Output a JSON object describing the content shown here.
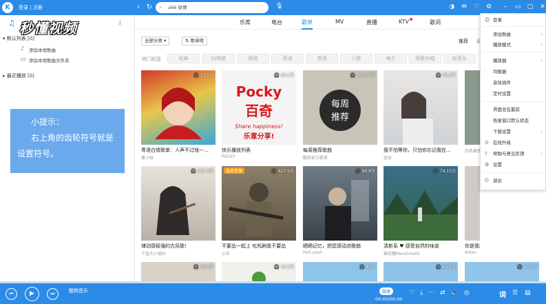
{
  "topbar": {
    "logo": "K",
    "login": "登录 | 注册",
    "search_value": "a66 梁博",
    "icons": [
      "back-icon",
      "refresh-icon",
      "mic-icon",
      "skin-icon",
      "mail-icon",
      "game-icon",
      "gear-icon",
      "minimize-icon",
      "mini-mode-icon",
      "close-icon"
    ]
  },
  "watermark": "秒懂视频",
  "sidebar": {
    "default_list": "默认列表 [0]",
    "add_local": "添加本地歌曲",
    "add_folder": "添加本地歌曲文件夹",
    "recent": "最近播放 [0]"
  },
  "tip": {
    "line1": "小提示：",
    "line2": "右上角的齿轮符号就是",
    "line3": "设置符号。"
  },
  "tabs": [
    {
      "label": "乐库",
      "active": false
    },
    {
      "label": "电台",
      "active": false
    },
    {
      "label": "歌单",
      "active": true
    },
    {
      "label": "MV",
      "active": false
    },
    {
      "label": "直播",
      "active": false
    },
    {
      "label": "KTV",
      "active": false
    },
    {
      "label": "歌词",
      "active": false
    }
  ],
  "filters": {
    "category": "全部分类 ▾",
    "chart": "歌单榜"
  },
  "sort": {
    "recommend": "推荐",
    "latest": "最"
  },
  "hot_tags_label": "热门标签",
  "hot_tags": [
    "经典",
    "DJ热碟",
    "网络",
    "英语",
    "粤语",
    "儿歌",
    "电子",
    "情歌对唱",
    "轻音乐"
  ],
  "cards_row1": [
    {
      "title": "粤语白情歌单：人声不过戏一...",
      "sub": "黄小妍",
      "plays": "73.5万"
    },
    {
      "title": "快乐播放列表",
      "sub": "POCKY",
      "plays": "29.1万"
    },
    {
      "title": "每周推荐歌曲",
      "sub": "酷狗官方歌单",
      "plays": "3600.6万"
    },
    {
      "title": "我不怕等你，只怕你忘记我在...",
      "sub": "念安",
      "plays": "58.6万"
    },
    {
      "title": "",
      "sub": "白色暑假",
      "plays": ""
    }
  ],
  "cards_row2": [
    {
      "title": "律动感极强的古风歌！",
      "sub": "千金大小姐M",
      "plays": "121.3万",
      "vip": ""
    },
    {
      "title": "不要怂一起上 吃鸡刷盘不要怂",
      "sub": "小灰",
      "plays": "427.9万",
      "vip": "会员专享"
    },
    {
      "title": "晒晒记忆，把您感动进歌曲",
      "sub": "Hell yeah",
      "plays": "90.8万",
      "vip": ""
    },
    {
      "title": "清新系 ♥ 感受自然的味道",
      "sub": "棉花糖Marshmello",
      "plays": "74.15万",
      "vip": ""
    },
    {
      "title": "你是我想念，是你想忘记的人",
      "sub": "Aiden",
      "plays": "",
      "vip": ""
    }
  ],
  "cards_row3": [
    {
      "plays": "38.7万"
    },
    {
      "plays": "16.5万"
    },
    {
      "plays": "42万"
    },
    {
      "plays": "63.2万"
    },
    {
      "plays": "67.6万"
    }
  ],
  "menu": {
    "items": [
      {
        "label": "登录",
        "icon": "user-icon",
        "arrow": false
      },
      {
        "label": "添加歌曲",
        "icon": "",
        "arrow": true
      },
      {
        "label": "播放模式",
        "icon": "",
        "arrow": true
      },
      {
        "label": "播放器",
        "icon": "",
        "arrow": true
      },
      {
        "label": "均衡器",
        "icon": "equalizer-icon",
        "arrow": false
      },
      {
        "label": "音效插件",
        "icon": "",
        "arrow": false
      },
      {
        "label": "定时设置",
        "icon": "",
        "arrow": false
      },
      {
        "label": "界面总在最前",
        "icon": "",
        "arrow": false
      },
      {
        "label": "恢复窗口默认状态",
        "icon": "",
        "arrow": false
      },
      {
        "label": "下载设置",
        "icon": "",
        "arrow": true
      },
      {
        "label": "在线升级",
        "icon": "upgrade-icon",
        "arrow": false
      },
      {
        "label": "帮助与意见反馈",
        "icon": "help-icon",
        "arrow": true
      },
      {
        "label": "设置",
        "icon": "gear-icon",
        "arrow": false
      },
      {
        "label": "退出",
        "icon": "power-icon",
        "arrow": false
      }
    ]
  },
  "player": {
    "title": "酷狗音乐",
    "mode": "极速",
    "time": "00:00/00:00",
    "lyric": "词",
    "progress": 0
  }
}
